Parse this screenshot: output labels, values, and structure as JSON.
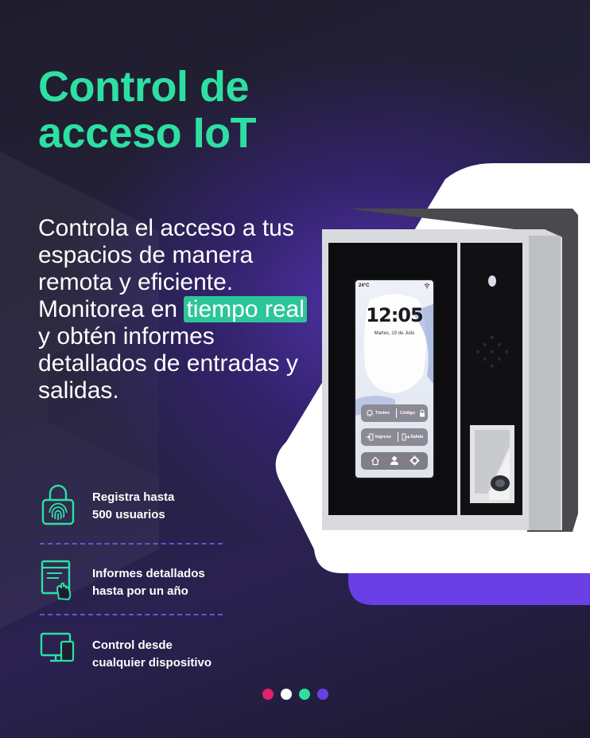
{
  "title": {
    "line1": "Control de",
    "line2": "acceso IoT"
  },
  "description": {
    "before": "Controla el acceso a tus espacios de manera remota y eficiente. Monitorea en",
    "highlight": "tiempo real",
    "after": "y obtén informes detallados de entradas y salidas."
  },
  "features": [
    {
      "icon": "fingerprint-lock-icon",
      "line1": "Registra hasta",
      "line2": "500 usuarios"
    },
    {
      "icon": "report-hand-icon",
      "line1": "Informes detallados",
      "line2": "hasta por un año"
    },
    {
      "icon": "devices-icon",
      "line1": "Control desde",
      "line2": "cualquier dispositivo"
    }
  ],
  "device_screen": {
    "temperature": "24°C",
    "time": "12:05",
    "date": "Martes, 19 de Julio",
    "button_doorbell": "Timbre",
    "button_code": "Código",
    "button_entry": "Ingreso",
    "button_exit": "Salida",
    "nav_icons": [
      "home-icon",
      "user-icon",
      "gear-icon"
    ]
  },
  "colors": {
    "accent_green": "#2de0a2",
    "highlight_green": "#2bc69a",
    "purple": "#6a3fe6",
    "pink": "#e0216e",
    "white": "#ffffff"
  },
  "pager_dots": [
    "#e0216e",
    "#ffffff",
    "#2de0a2",
    "#6a3fe6"
  ]
}
